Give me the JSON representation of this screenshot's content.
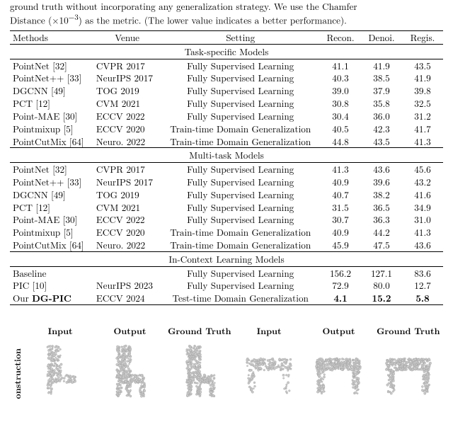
{
  "caption": {
    "line1": "ground truth without incorporating any generalization strategy. We use the Chamfer",
    "line2_before": "Distance (×10",
    "line2_sup": "−3",
    "line2_after": ") as the metric. (The lower value indicates a better performance)."
  },
  "headers": {
    "methods": "Methods",
    "venue": "Venue",
    "setting": "Setting",
    "recon": "Recon.",
    "denoi": "Denoi.",
    "regis": "Regis."
  },
  "sections": [
    {
      "title": "Task-specific Models",
      "rows": [
        {
          "method": "PointNet [32]",
          "venue": "CVPR 2017",
          "setting": "Fully Supervised Learning",
          "recon": "41.1",
          "denoi": "41.9",
          "regis": "43.5"
        },
        {
          "method": "PointNet++ [33]",
          "venue": "NeurIPS 2017",
          "setting": "Fully Supervised Learning",
          "recon": "40.3",
          "denoi": "38.5",
          "regis": "41.9"
        },
        {
          "method": "DGCNN [49]",
          "venue": "TOG 2019",
          "setting": "Fully Supervised Learning",
          "recon": "39.0",
          "denoi": "37.9",
          "regis": "39.8"
        },
        {
          "method": "PCT [12]",
          "venue": "CVM 2021",
          "setting": "Fully Supervised Learning",
          "recon": "30.8",
          "denoi": "35.8",
          "regis": "32.5"
        },
        {
          "method": "Point-MAE [30]",
          "venue": "ECCV 2022",
          "setting": "Fully Supervised Learning",
          "recon": "30.4",
          "denoi": "36.0",
          "regis": "31.2"
        },
        {
          "method": "Pointmixup [5]",
          "venue": "ECCV 2020",
          "setting": "Train-time Domain Generalization",
          "recon": "40.5",
          "denoi": "42.3",
          "regis": "41.7"
        },
        {
          "method": "PointCutMix [64]",
          "venue": "Neuro. 2022",
          "setting": "Train-time Domain Generalization",
          "recon": "44.8",
          "denoi": "43.5",
          "regis": "41.3"
        }
      ]
    },
    {
      "title": "Multi-task Models",
      "rows": [
        {
          "method": "PointNet [32]",
          "venue": "CVPR 2017",
          "setting": "Fully Supervised Learning",
          "recon": "41.3",
          "denoi": "43.6",
          "regis": "45.6"
        },
        {
          "method": "PointNet++ [33]",
          "venue": "NeurIPS 2017",
          "setting": "Fully Supervised Learning",
          "recon": "40.9",
          "denoi": "39.6",
          "regis": "43.2"
        },
        {
          "method": "DGCNN [49]",
          "venue": "TOG 2019",
          "setting": "Fully Supervised Learning",
          "recon": "40.7",
          "denoi": "38.2",
          "regis": "41.6"
        },
        {
          "method": "PCT [12]",
          "venue": "CVM 2021",
          "setting": "Fully Supervised Learning",
          "recon": "31.5",
          "denoi": "36.5",
          "regis": "34.9"
        },
        {
          "method": "Point-MAE [30]",
          "venue": "ECCV 2022",
          "setting": "Fully Supervised Learning",
          "recon": "30.7",
          "denoi": "36.3",
          "regis": "31.0"
        },
        {
          "method": "Pointmixup [5]",
          "venue": "ECCV 2020",
          "setting": "Train-time Domain Generalization",
          "recon": "40.9",
          "denoi": "44.2",
          "regis": "41.3"
        },
        {
          "method": "PointCutMix [64]",
          "venue": "Neuro. 2022",
          "setting": "Train-time Domain Generalization",
          "recon": "45.9",
          "denoi": "47.5",
          "regis": "43.6"
        }
      ]
    },
    {
      "title": "In-Context Learning Models",
      "rows": [
        {
          "method": "Baseline",
          "venue": "",
          "setting": "Fully Supervised Learning",
          "recon": "156.2",
          "denoi": "127.1",
          "regis": "83.6"
        },
        {
          "method": "PIC [10]",
          "venue": "NeurIPS 2023",
          "setting": "Fully Supervised Learning",
          "recon": "72.9",
          "denoi": "80.0",
          "regis": "12.7"
        },
        {
          "method": "Our <b>DG-PIC</b>",
          "venue": "ECCV 2024",
          "setting": "Test-time Domain Generalization",
          "recon": "4.1",
          "denoi": "15.2",
          "regis": "5.8",
          "bold": true
        }
      ]
    }
  ],
  "figure": {
    "sidelabel": "onstruction",
    "cols": [
      "Input",
      "Output",
      "Ground Truth",
      "Input",
      "Output",
      "Ground Truth"
    ]
  }
}
